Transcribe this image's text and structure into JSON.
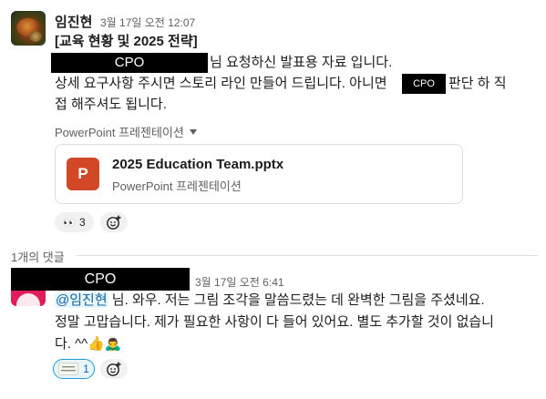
{
  "message1": {
    "author": "임진현",
    "timestamp": "3월 17일 오전 12:07",
    "title_line": "[교육 현황 및 2025 전략]",
    "redacted_name": "CPO",
    "line2_suffix": "님 요청하신 발표용 자료 입니다.",
    "line3_prefix": "상세 요구사항 주시면 스토리 라인 만들어 드립니다. 아니면",
    "line3_redacted": "CPO",
    "line3_suffix": "판단 하 직",
    "line4": "접 해주셔도 됩니다.",
    "attachment_label": "PowerPoint 프레젠테이션",
    "file": {
      "icon_letter": "P",
      "name": "2025 Education Team.pptx",
      "type": "PowerPoint 프레젠테이션"
    },
    "reactions": [
      {
        "emoji": "👀",
        "count": "3"
      }
    ]
  },
  "thread": {
    "reply_count_label": "1개의 댓글"
  },
  "message2": {
    "author_redacted": "CPO",
    "timestamp": "3월 17일 오전 6:41",
    "mention": "@임진현",
    "line1_suffix": " 님. 와우. 저는 그림 조각을 말씀드렸는 데 완벽한 그림을 주셨네요.",
    "line2": "정말 고맙습니다. 제가 필요한 사항이 다 들어 있어요. 별도 추가할 것이 없습니",
    "line3": "다. ^^👍🙇‍♂️",
    "reactions": [
      {
        "emoji": "custom-logo",
        "count": "1"
      }
    ]
  },
  "colors": {
    "ppt": "#d24726",
    "mention_bg": "#e8f5fa",
    "mention_text": "#1264a3",
    "avatar2": "#e01e5a"
  }
}
